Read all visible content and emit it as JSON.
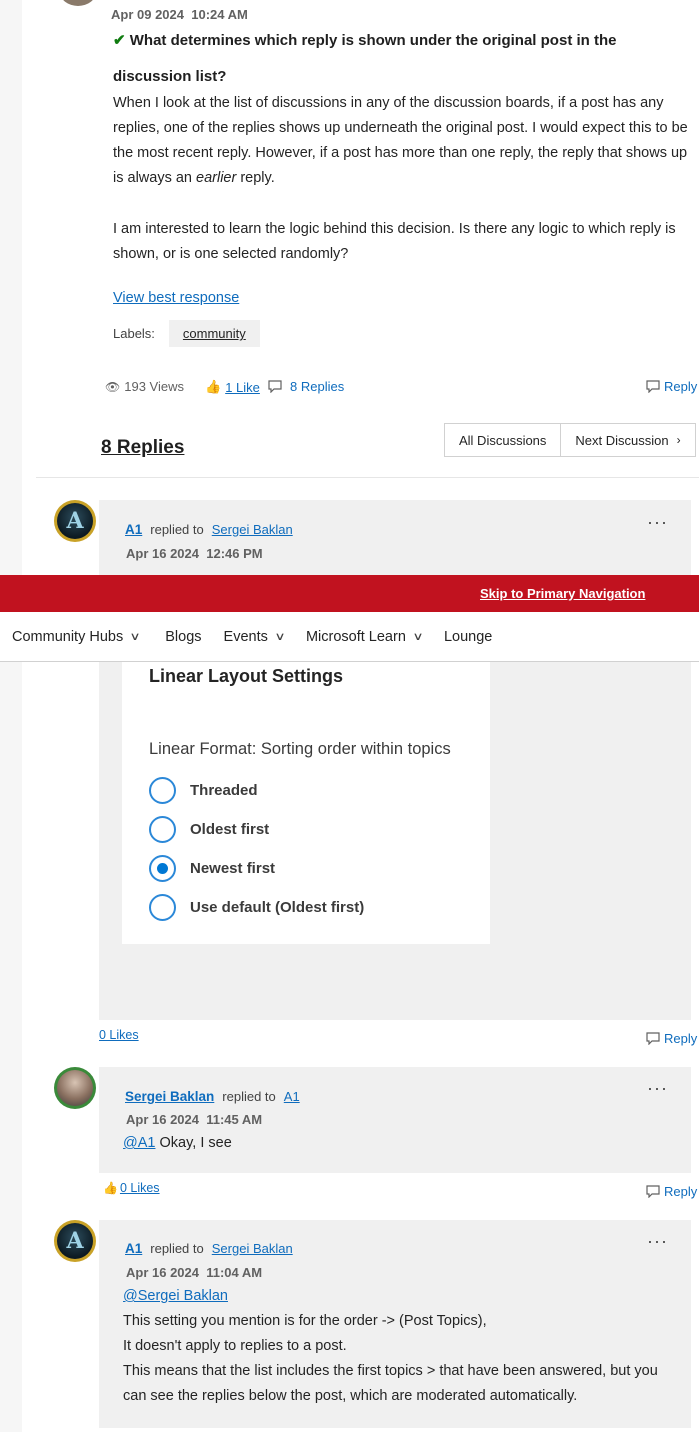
{
  "original_post": {
    "date": "Apr 09 2024",
    "time": "10:24 AM",
    "title": "What determines which reply is shown under the original post in the discussion list?",
    "paragraph1_a": "When I look at the list of discussions in any of the discussion boards, if a post has any replies, one of the replies shows up underneath the original post. I would expect this to be the most recent reply. However, if a post has more than one reply, the reply that shows up is always an ",
    "paragraph1_em": "earlier",
    "paragraph1_b": " reply.",
    "paragraph2": "I am interested to learn the logic behind this decision. Is there any logic to which reply is shown, or is one selected randomly?",
    "best_response_link": "View best response",
    "labels_label": "Labels:",
    "label_tag": "community",
    "views": "193 Views",
    "likes": "1 Like",
    "replies": "8 Replies",
    "reply_button": "Reply"
  },
  "replies_section": {
    "heading": "8 Replies",
    "all_discussions": "All Discussions",
    "next_discussion": "Next Discussion"
  },
  "reply1": {
    "author": "A1",
    "replied_to_text": "replied to",
    "replied_to": "Sergei Baklan",
    "date": "Apr 16 2024",
    "time": "12:46 PM",
    "likes": "0 Likes",
    "reply_button": "Reply",
    "settings": {
      "title": "Linear Layout Settings",
      "subtitle": "Linear Format: Sorting order within topics",
      "options": [
        "Threaded",
        "Oldest first",
        "Newest first",
        "Use default (Oldest first)"
      ],
      "selected": "Newest first"
    }
  },
  "banner": {
    "skip_link": "Skip to Primary Navigation",
    "color": "#c1121f"
  },
  "nav": {
    "items": [
      "Community Hubs",
      "Blogs",
      "Events",
      "Microsoft Learn",
      "Lounge"
    ]
  },
  "reply2": {
    "author": "Sergei Baklan",
    "replied_to_text": "replied to",
    "replied_to": "A1",
    "date": "Apr 16 2024",
    "time": "11:45 AM",
    "mention": "@A1",
    "text": " Okay, I see",
    "likes": "0 Likes",
    "reply_button": "Reply"
  },
  "reply3": {
    "author": "A1",
    "replied_to_text": "replied to",
    "replied_to": "Sergei Baklan",
    "date": "Apr 16 2024",
    "time": "11:04 AM",
    "mention": "@Sergei Baklan",
    "line1": "This setting you mention is for the order -> (Post Topics),",
    "line2": "It doesn't apply to replies to a post.",
    "line3": "This means that the list includes the first topics > that have been answered, but you can see the replies below the post, which are moderated automatically."
  },
  "colors": {
    "link": "#0f6cbd",
    "accepted": "#107c10",
    "banner": "#c1121f",
    "radio": "#0078d4"
  }
}
